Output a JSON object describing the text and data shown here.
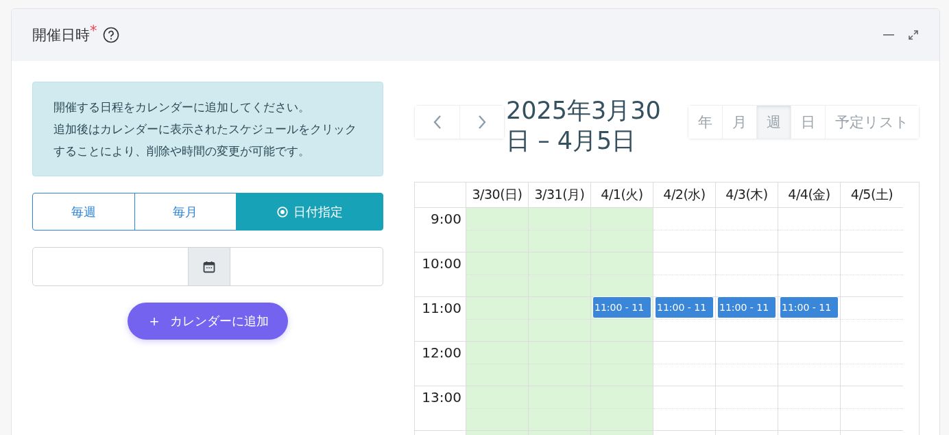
{
  "panel": {
    "title": "開催日時",
    "required_mark": "*"
  },
  "notice": {
    "lines": [
      "開催する日程をカレンダーに追加してください。",
      "追加後はカレンダーに表示されたスケジュールをクリックすることにより、削除や時間の変更が可能です。"
    ]
  },
  "mode_tabs": [
    {
      "label": "毎週",
      "selected": false
    },
    {
      "label": "毎月",
      "selected": false
    },
    {
      "label": "日付指定",
      "selected": true
    }
  ],
  "add_button": {
    "icon": "＋",
    "label": "カレンダーに追加"
  },
  "calendar": {
    "title": "2025年3月30日 – 4月5日",
    "views": [
      {
        "label": "年",
        "selected": false
      },
      {
        "label": "月",
        "selected": false
      },
      {
        "label": "週",
        "selected": true
      },
      {
        "label": "日",
        "selected": false
      },
      {
        "label": "予定リスト",
        "selected": false
      }
    ],
    "days": [
      {
        "label": "3/30(日)",
        "highlighted": true
      },
      {
        "label": "3/31(月)",
        "highlighted": true
      },
      {
        "label": "4/1(火)",
        "highlighted": true
      },
      {
        "label": "4/2(水)",
        "highlighted": false
      },
      {
        "label": "4/3(木)",
        "highlighted": false
      },
      {
        "label": "4/4(金)",
        "highlighted": false
      },
      {
        "label": "4/5(土)",
        "highlighted": false
      }
    ],
    "rows": [
      {
        "time": "9:00",
        "cells": [
          {},
          {},
          {},
          {},
          {},
          {},
          {}
        ]
      },
      {
        "time": "10:00",
        "cells": [
          {},
          {},
          {},
          {},
          {},
          {},
          {}
        ]
      },
      {
        "time": "11:00",
        "cells": [
          {},
          {},
          {
            "event": "11:00 - 11"
          },
          {
            "event": "11:00 - 11"
          },
          {
            "event": "11:00 - 11"
          },
          {
            "event": "11:00 - 11"
          },
          {}
        ]
      },
      {
        "time": "12:00",
        "cells": [
          {},
          {},
          {},
          {},
          {},
          {},
          {}
        ]
      },
      {
        "time": "13:00",
        "cells": [
          {},
          {},
          {},
          {},
          {},
          {},
          {}
        ]
      }
    ]
  }
}
